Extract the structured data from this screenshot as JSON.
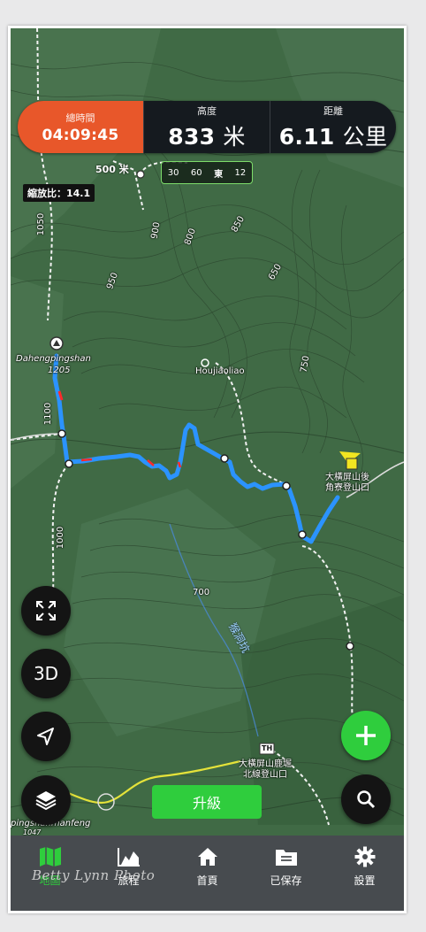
{
  "stats": {
    "total_time_label": "總時間",
    "total_time_value": "04:09:45",
    "altitude_label": "高度",
    "altitude_value": "833",
    "altitude_unit": "米",
    "distance_label": "距離",
    "distance_value": "6.11",
    "distance_unit": "公里"
  },
  "scale_bar": "500 米",
  "zoom_badge": "縮放比：14.1",
  "compass": {
    "a": "30",
    "b": "60",
    "c": "東",
    "d": "12"
  },
  "map_labels": {
    "peak_name": "Dahengpingshan",
    "peak_elev": "1205",
    "place": "Houjiaoliao",
    "trailhead_1_line1": "大橫屏山後",
    "trailhead_1_line2": "角寮登山口",
    "trailhead_2_line1": "大橫屏山鹿堀",
    "trailhead_2_line2": "北線登山口",
    "river": "猴洞坑",
    "th_badge": "TH",
    "bottom_place": "pingshanmanfeng",
    "bottom_elev": "1047"
  },
  "contours": [
    "1050",
    "950",
    "900",
    "850",
    "800",
    "750",
    "700",
    "650",
    "1100",
    "1000"
  ],
  "buttons": {
    "fullscreen": "",
    "three_d": "3D",
    "upgrade": "升級"
  },
  "tabs": [
    {
      "label": "地圖",
      "icon": "map-icon"
    },
    {
      "label": "旅程",
      "icon": "chart-icon"
    },
    {
      "label": "首頁",
      "icon": "home-icon"
    },
    {
      "label": "已保存",
      "icon": "folder-icon"
    },
    {
      "label": "設置",
      "icon": "gear-icon"
    }
  ],
  "watermark": "Betty Lynn Photo",
  "colors": {
    "accent": "#2fcd3d",
    "time_bg": "#e8572a",
    "route": "#2b93ff",
    "map_bg": "#3f6b45"
  }
}
